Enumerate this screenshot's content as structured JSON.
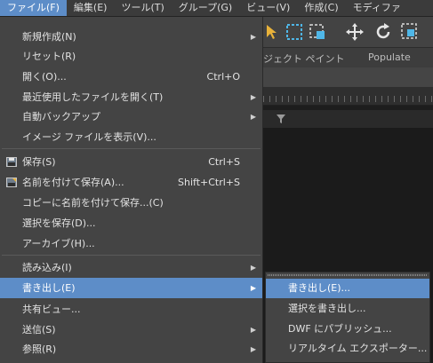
{
  "menubar": {
    "items": [
      {
        "label": "ファイル(F)"
      },
      {
        "label": "編集(E)"
      },
      {
        "label": "ツール(T)"
      },
      {
        "label": "グループ(G)"
      },
      {
        "label": "ビュー(V)"
      },
      {
        "label": "作成(C)"
      },
      {
        "label": "モディファ"
      }
    ]
  },
  "background": {
    "ribbon_tabs": [
      "ジェクト ペイント",
      "Populate"
    ]
  },
  "file_menu": {
    "items": [
      {
        "label": "新規作成(N)",
        "shortcut": "",
        "submenu": true
      },
      {
        "label": "リセット(R)",
        "shortcut": "",
        "submenu": false
      },
      {
        "label": "開く(O)...",
        "shortcut": "Ctrl+O",
        "submenu": false
      },
      {
        "label": "最近使用したファイルを開く(T)",
        "shortcut": "",
        "submenu": true
      },
      {
        "label": "自動バックアップ",
        "shortcut": "",
        "submenu": true
      },
      {
        "label": "イメージ ファイルを表示(V)...",
        "shortcut": "",
        "submenu": false
      },
      {
        "label": "保存(S)",
        "shortcut": "Ctrl+S",
        "submenu": false
      },
      {
        "label": "名前を付けて保存(A)...",
        "shortcut": "Shift+Ctrl+S",
        "submenu": false
      },
      {
        "label": "コピーに名前を付けて保存...(C)",
        "shortcut": "",
        "submenu": false
      },
      {
        "label": "選択を保存(D)...",
        "shortcut": "",
        "submenu": false
      },
      {
        "label": "アーカイブ(H)...",
        "shortcut": "",
        "submenu": false
      },
      {
        "label": "読み込み(I)",
        "shortcut": "",
        "submenu": true
      },
      {
        "label": "書き出し(E)",
        "shortcut": "",
        "submenu": true
      },
      {
        "label": "共有ビュー...",
        "shortcut": "",
        "submenu": false
      },
      {
        "label": "送信(S)",
        "shortcut": "",
        "submenu": true
      },
      {
        "label": "参照(R)",
        "shortcut": "",
        "submenu": true
      }
    ]
  },
  "export_submenu": {
    "items": [
      {
        "label": "書き出し(E)..."
      },
      {
        "label": "選択を書き出し..."
      },
      {
        "label": "DWF にパブリッシュ..."
      },
      {
        "label": "リアルタイム エクスポーター..."
      }
    ]
  },
  "colors": {
    "highlight": "#5d8dc8",
    "menu_bg": "#444444",
    "menubar_bg": "#3b3b3b"
  }
}
